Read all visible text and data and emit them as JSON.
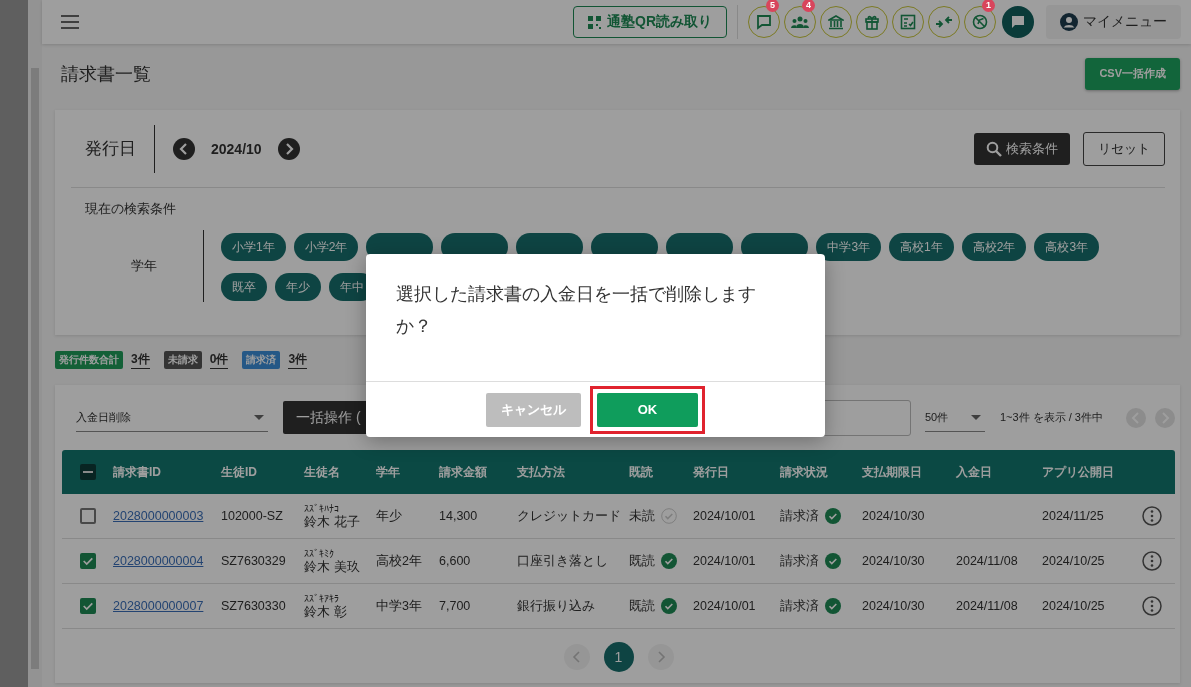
{
  "header": {
    "qr_button": "通塾QR読み取り",
    "icon_buttons": [
      {
        "has_badge": true,
        "badge": "5"
      },
      {
        "has_badge": true,
        "badge": "4"
      },
      {
        "has_badge": false
      },
      {
        "has_badge": false
      },
      {
        "has_badge": false
      },
      {
        "has_badge": false
      },
      {
        "has_badge": true,
        "badge": "1"
      }
    ],
    "my_menu": "マイメニュー"
  },
  "page_title": "請求書一覧",
  "csv_button": "CSV一括作成",
  "filter": {
    "date_label": "発行日",
    "date_value": "2024/10",
    "search_button": "検索条件",
    "reset_button": "リセット",
    "current_label": "現在の検索条件",
    "grade_label": "学年",
    "grade_chip_rows": [
      [
        {
          "label": "小学1年",
          "covered": false
        },
        {
          "label": "小学2年",
          "covered": false
        },
        {
          "covered": true
        },
        {
          "covered": true
        },
        {
          "covered": true
        },
        {
          "covered": true
        },
        {
          "covered": true
        },
        {
          "covered": true
        },
        {
          "label": "中学3年",
          "covered": false
        },
        {
          "label": "高校1年",
          "covered": false
        },
        {
          "label": "高校2年",
          "covered": false
        },
        {
          "label": "高校3年",
          "covered": false
        }
      ],
      [
        {
          "label": "既卒",
          "covered": false
        },
        {
          "label": "年少",
          "covered": false
        },
        {
          "label": "年中",
          "covered": false
        }
      ]
    ]
  },
  "stats": [
    {
      "label": "発行件数合計",
      "value": "3件",
      "color": "#136038"
    },
    {
      "label": "未請求",
      "value": "0件",
      "color": "#353535"
    },
    {
      "label": "請求済",
      "value": "3件",
      "color": "#255886"
    }
  ],
  "toolbar": {
    "action_select": "入金日削除",
    "bulk_button": "一括操作 (",
    "page_size": "50件",
    "range": "1~3件 を表示 / 3件中"
  },
  "table": {
    "header_indeterminate": true,
    "columns": [
      "請求書ID",
      "生徒ID",
      "生徒名",
      "学年",
      "請求金額",
      "支払方法",
      "既読",
      "発行日",
      "請求状況",
      "支払期限日",
      "入金日",
      "アプリ公開日"
    ],
    "rows": [
      {
        "selected": false,
        "invoice_id": "2028000000003",
        "student_id": "102000-SZ",
        "kana": "ｽｽﾞｷﾊﾅｺ",
        "name": "鈴木 花子",
        "grade": "年少",
        "amount": "14,300",
        "payment": "クレジットカード",
        "read_label": "未読",
        "read": false,
        "issued": "2024/10/01",
        "status": "請求済",
        "status_done": true,
        "due": "2024/10/30",
        "published": "2024/11/25"
      },
      {
        "selected": true,
        "invoice_id": "2028000000004",
        "student_id": "SZ7630329",
        "kana": "ｽｽﾞｷﾐｸ",
        "name": "鈴木 美玖",
        "grade": "高校2年",
        "amount": "6,600",
        "payment": "口座引き落とし",
        "read_label": "既読",
        "read": true,
        "issued": "2024/10/01",
        "status": "請求済",
        "status_done": true,
        "due": "2024/10/30",
        "paid": "2024/11/08",
        "published": "2024/10/25"
      },
      {
        "selected": true,
        "invoice_id": "2028000000007",
        "student_id": "SZ7630330",
        "kana": "ｽｽﾞｷｱｷﾗ",
        "name": "鈴木 彰",
        "grade": "中学3年",
        "amount": "7,700",
        "payment": "銀行振り込み",
        "read_label": "既読",
        "read": true,
        "issued": "2024/10/01",
        "status": "請求済",
        "status_done": true,
        "due": "2024/10/30",
        "paid": "2024/11/08",
        "published": "2024/10/25"
      }
    ]
  },
  "pagination": {
    "pages": [
      {
        "label": "1",
        "selected": true
      }
    ]
  },
  "dialog": {
    "message": "選択した請求書の入金日を一括で削除しますか？",
    "cancel": "キャンセル",
    "ok": "OK",
    "ok_highlighted": true
  }
}
